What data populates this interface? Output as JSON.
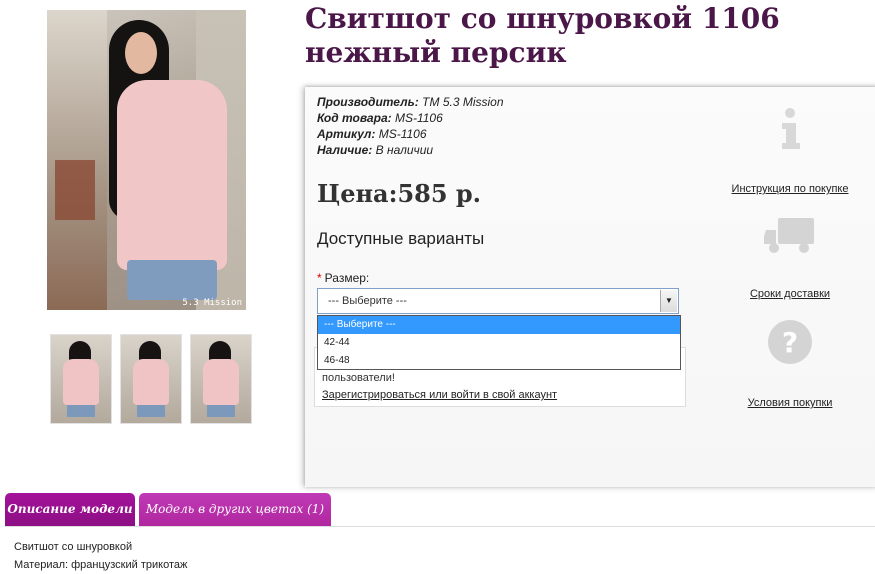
{
  "product": {
    "title": "Свитшот со шнуровкой 1106 нежный персик",
    "watermark": "5.3 Mission",
    "specs": [
      {
        "label": "Производитель:",
        "value": "ТМ 5.3 Mission"
      },
      {
        "label": "Код товара:",
        "value": "MS-1106"
      },
      {
        "label": "Артикул:",
        "value": "MS-1106"
      },
      {
        "label": "Наличие:",
        "value": "В наличии"
      }
    ],
    "price": "Цена:585 р.",
    "variants_title": "Доступные варианты",
    "size_label": "Размер:",
    "required_mark": "*",
    "select_value": "--- Выберите ---",
    "options": [
      "--- Выберите ---",
      "42-44",
      "46-48"
    ]
  },
  "notice": {
    "text": "пользователи!",
    "link": "Зарегистрироваться или войти в свой аккаунт"
  },
  "info_links": [
    {
      "label": "Инструкция по покупке",
      "icon": "info-icon"
    },
    {
      "label": "Сроки доставки",
      "icon": "truck-icon"
    },
    {
      "label": "Условия покупки",
      "icon": "question-icon"
    }
  ],
  "tabs": [
    {
      "label": "Описание модели"
    },
    {
      "label": "Модель в других цветах (1)"
    }
  ],
  "description": [
    "Свитшот со шнуровкой",
    "Материал: французский трикотаж"
  ],
  "colors": {
    "title": "#4a1748",
    "tab_active": "#8c0f84",
    "tab_other": "#b0279f",
    "option_selected": "#3399ff"
  }
}
